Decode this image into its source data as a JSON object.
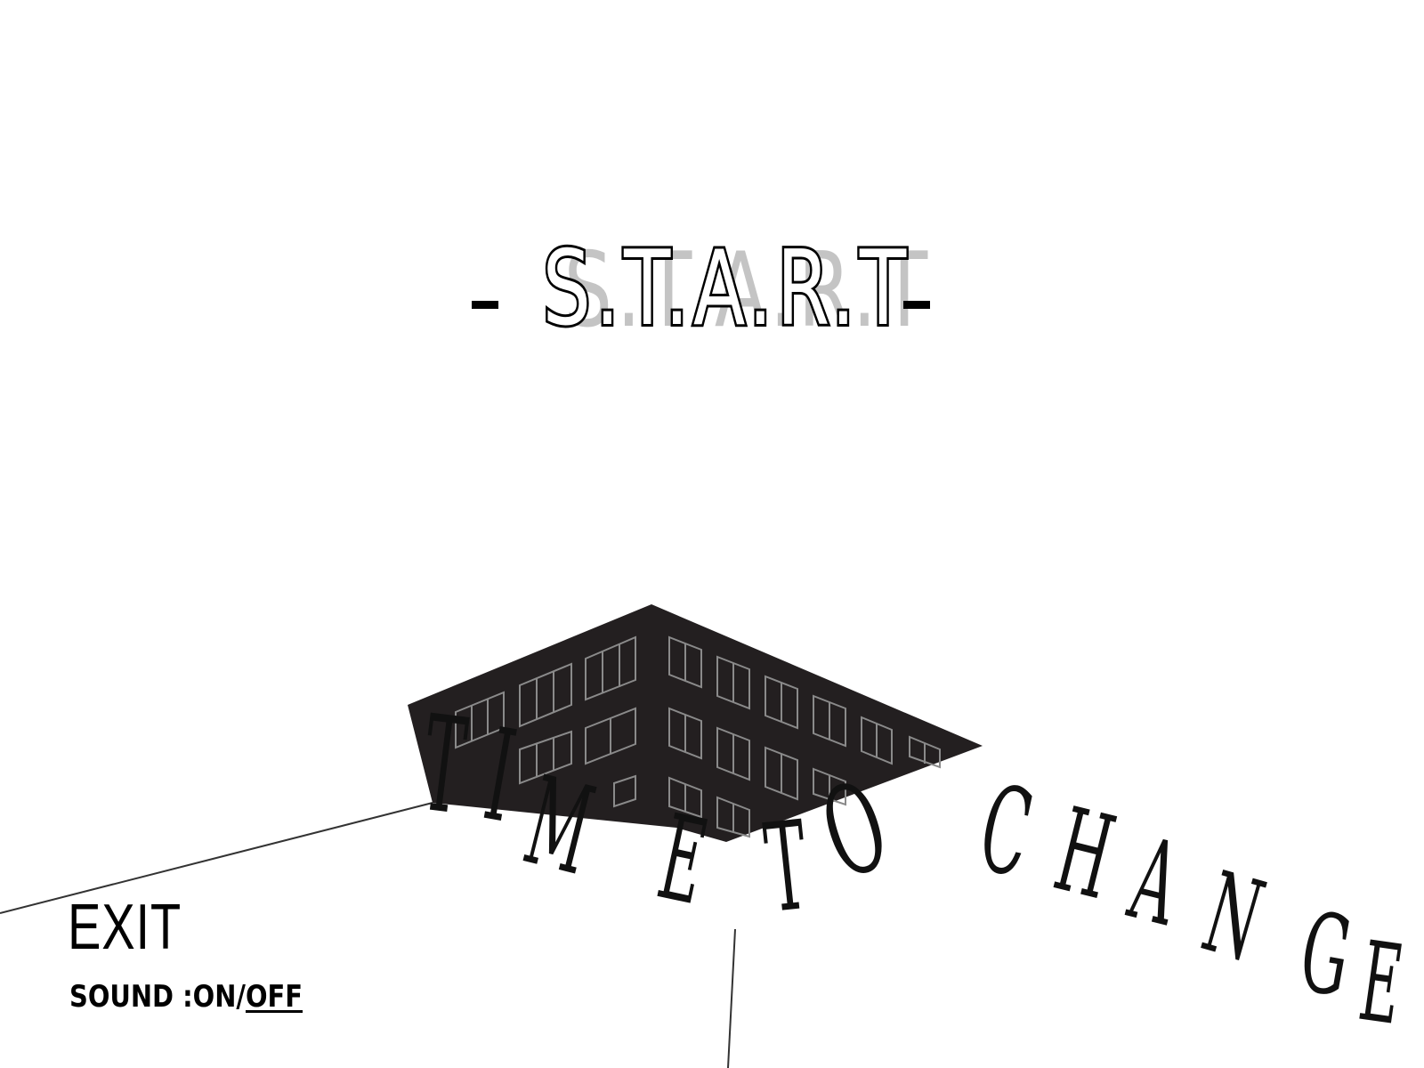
{
  "menu": {
    "start_label": "S.T.A.R.T",
    "title": "TIME TO CHANGE",
    "exit_label": "EXIT",
    "sound_label": "SOUND : ",
    "sound_on": "ON",
    "sound_separator": "/",
    "sound_off": "OFF",
    "sound_selected": "OFF"
  }
}
